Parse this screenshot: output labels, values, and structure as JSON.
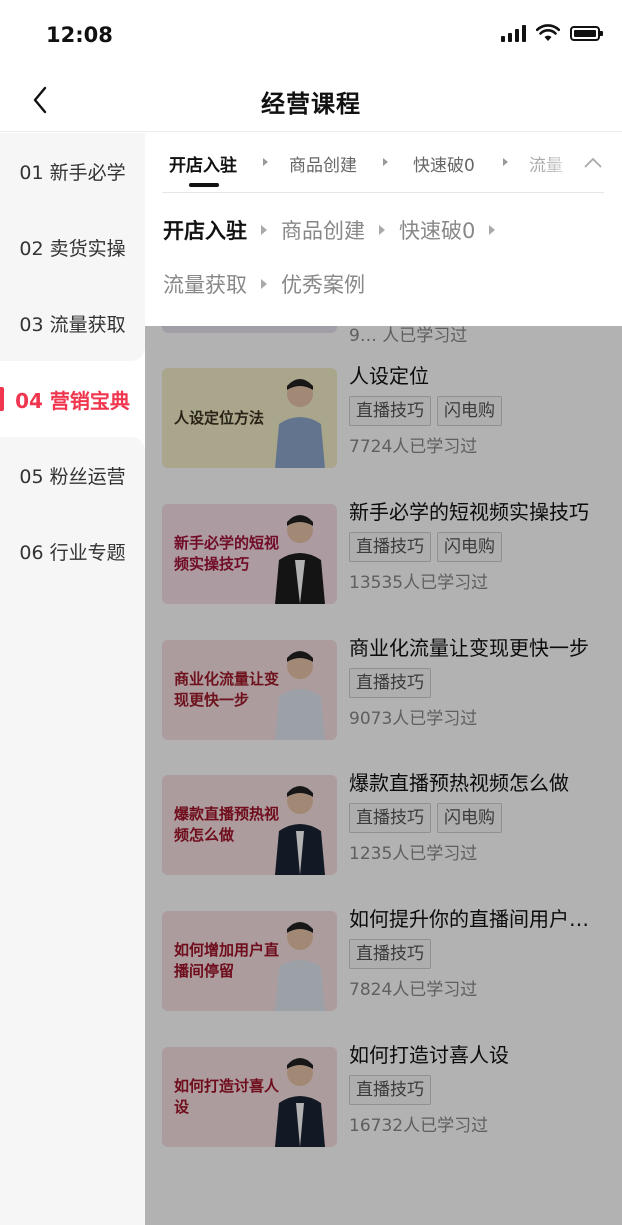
{
  "status_bar": {
    "time": "12:08"
  },
  "nav": {
    "title": "经营课程"
  },
  "sidebar": {
    "items": [
      {
        "label": "01 新手必学"
      },
      {
        "label": "02 卖货实操"
      },
      {
        "label": "03 流量获取"
      },
      {
        "label": "04 营销宝典"
      },
      {
        "label": "05 粉丝运营"
      },
      {
        "label": "06 行业专题"
      }
    ],
    "active_index": 3,
    "active_color": "#f0364f"
  },
  "stage_tabs": {
    "items": [
      {
        "label": "开店入驻"
      },
      {
        "label": "商品创建"
      },
      {
        "label": "快速破0"
      },
      {
        "label": "流量"
      }
    ],
    "active_index": 0
  },
  "stage_panel": {
    "rows": [
      [
        {
          "label": "开店入驻"
        },
        {
          "label": "商品创建"
        },
        {
          "label": "快速破0"
        }
      ],
      [
        {
          "label": "流量获取"
        },
        {
          "label": "优秀案例"
        }
      ]
    ],
    "active_label": "开店入驻"
  },
  "partial_course": {
    "learned": "9… 人已学习过"
  },
  "courses": [
    {
      "thumb_text": "人设定位方法",
      "thumb_bg": "#f4eec7",
      "thumb_text_color": "#3a3320",
      "title": "人设定位",
      "tags": [
        "直播技巧",
        "闪电购"
      ],
      "learned": "7724人已学习过"
    },
    {
      "thumb_text": "新手必学的短视频实操技巧",
      "thumb_bg": "#f6dfe6",
      "thumb_text_color": "#a3123a",
      "title": "新手必学的短视频实操技巧",
      "tags": [
        "直播技巧",
        "闪电购"
      ],
      "learned": "13535人已学习过"
    },
    {
      "thumb_text": "商业化流量让变现更快一步",
      "thumb_bg": "#f8e0e1",
      "thumb_text_color": "#9e1a2c",
      "title": "商业化流量让变现更快一步",
      "tags": [
        "直播技巧"
      ],
      "learned": "9073人已学习过"
    },
    {
      "thumb_text": "爆款直播预热视频怎么做",
      "thumb_bg": "#f8e0e1",
      "thumb_text_color": "#a0142a",
      "title": "爆款直播预热视频怎么做",
      "tags": [
        "直播技巧",
        "闪电购"
      ],
      "learned": "1235人已学习过"
    },
    {
      "thumb_text": "如何增加用户直播间停留",
      "thumb_bg": "#f8e0e1",
      "thumb_text_color": "#a0142a",
      "title": "如何提升你的直播间用户…",
      "tags": [
        "直播技巧"
      ],
      "learned": "7824人已学习过"
    },
    {
      "thumb_text": "如何打造讨喜人设",
      "thumb_bg": "#f8e0e1",
      "thumb_text_color": "#a0142a",
      "title": "如何打造讨喜人设",
      "tags": [
        "直播技巧"
      ],
      "learned": "16732人已学习过"
    }
  ]
}
